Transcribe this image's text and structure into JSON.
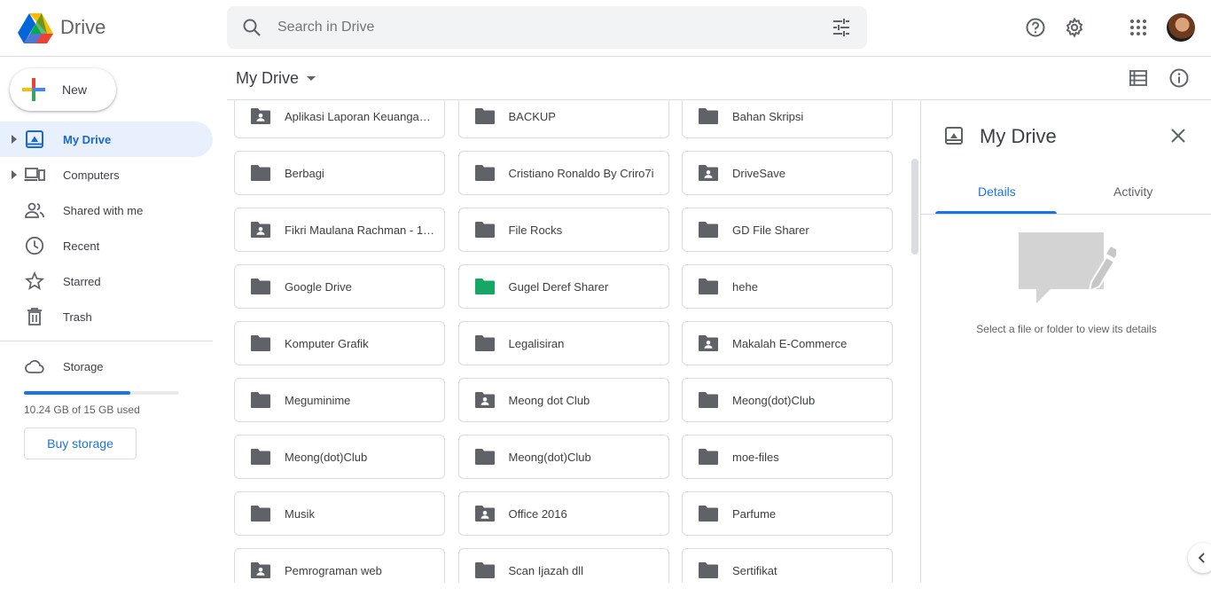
{
  "app": {
    "name": "Drive"
  },
  "search": {
    "placeholder": "Search in Drive"
  },
  "sidebar": {
    "new_label": "New",
    "items": [
      {
        "label": "My Drive",
        "icon": "my-drive-icon",
        "active": true,
        "expandable": true
      },
      {
        "label": "Computers",
        "icon": "computers-icon",
        "active": false,
        "expandable": true
      },
      {
        "label": "Shared with me",
        "icon": "shared-icon",
        "active": false,
        "expandable": false
      },
      {
        "label": "Recent",
        "icon": "clock-icon",
        "active": false,
        "expandable": false
      },
      {
        "label": "Starred",
        "icon": "star-icon",
        "active": false,
        "expandable": false
      },
      {
        "label": "Trash",
        "icon": "trash-icon",
        "active": false,
        "expandable": false
      }
    ],
    "storage": {
      "label": "Storage",
      "used_text": "10.24 GB of 15 GB used",
      "used_fraction": 0.683,
      "buy_label": "Buy storage"
    }
  },
  "toolbar": {
    "breadcrumb": "My Drive"
  },
  "folders": [
    {
      "name": "Aplikasi Laporan Keuangan Sederhana",
      "shared": true,
      "color": "#5f6368"
    },
    {
      "name": "BACKUP",
      "shared": false,
      "color": "#5f6368"
    },
    {
      "name": "Bahan Skripsi",
      "shared": false,
      "color": "#5f6368"
    },
    {
      "name": "Berbagi",
      "shared": false,
      "color": "#5f6368"
    },
    {
      "name": "Cristiano Ronaldo By Criro7i",
      "shared": false,
      "color": "#5f6368"
    },
    {
      "name": "DriveSave",
      "shared": true,
      "color": "#5f6368"
    },
    {
      "name": "Fikri Maulana Rachman - 1…",
      "shared": true,
      "color": "#5f6368"
    },
    {
      "name": "File Rocks",
      "shared": false,
      "color": "#5f6368"
    },
    {
      "name": "GD File Sharer",
      "shared": false,
      "color": "#5f6368"
    },
    {
      "name": "Google Drive",
      "shared": false,
      "color": "#5f6368"
    },
    {
      "name": "Gugel Deref Sharer",
      "shared": false,
      "color": "#16a765"
    },
    {
      "name": "hehe",
      "shared": false,
      "color": "#5f6368"
    },
    {
      "name": "Komputer Grafik",
      "shared": false,
      "color": "#5f6368"
    },
    {
      "name": "Legalisiran",
      "shared": false,
      "color": "#5f6368"
    },
    {
      "name": "Makalah E-Commerce",
      "shared": true,
      "color": "#5f6368"
    },
    {
      "name": "Meguminime",
      "shared": false,
      "color": "#5f6368"
    },
    {
      "name": "Meong dot Club",
      "shared": true,
      "color": "#5f6368"
    },
    {
      "name": "Meong(dot)Club",
      "shared": false,
      "color": "#5f6368"
    },
    {
      "name": "Meong(dot)Club",
      "shared": false,
      "color": "#5f6368"
    },
    {
      "name": "Meong(dot)Club",
      "shared": false,
      "color": "#5f6368"
    },
    {
      "name": "moe-files",
      "shared": false,
      "color": "#5f6368"
    },
    {
      "name": "Musik",
      "shared": false,
      "color": "#5f6368"
    },
    {
      "name": "Office 2016",
      "shared": true,
      "color": "#5f6368"
    },
    {
      "name": "Parfume",
      "shared": false,
      "color": "#5f6368"
    },
    {
      "name": "Pemrograman web",
      "shared": true,
      "color": "#5f6368"
    },
    {
      "name": "Scan Ijazah dll",
      "shared": false,
      "color": "#5f6368"
    },
    {
      "name": "Sertifikat",
      "shared": false,
      "color": "#5f6368"
    }
  ],
  "details_panel": {
    "title": "My Drive",
    "tabs": [
      "Details",
      "Activity"
    ],
    "active_tab": 0,
    "hint": "Select a file or folder to view its details"
  }
}
